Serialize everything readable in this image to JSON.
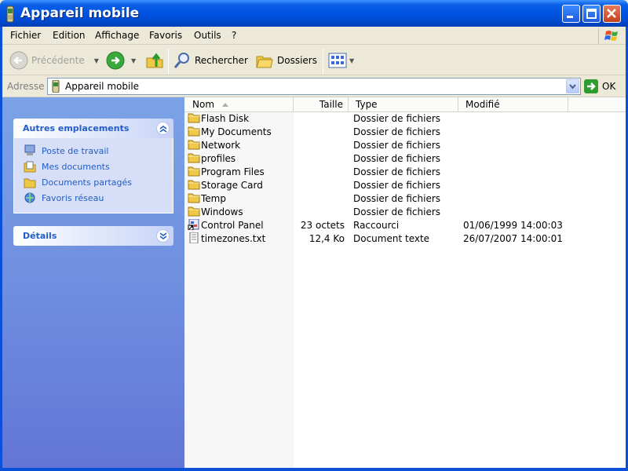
{
  "window": {
    "title": "Appareil mobile"
  },
  "menu": [
    "Fichier",
    "Edition",
    "Affichage",
    "Favoris",
    "Outils",
    "?"
  ],
  "toolbar": {
    "back_label": "Précédente",
    "search_label": "Rechercher",
    "folders_label": "Dossiers"
  },
  "address": {
    "label": "Adresse",
    "value": "Appareil mobile",
    "go_label": "OK"
  },
  "sidebar": {
    "other_places": {
      "title": "Autres emplacements",
      "items": [
        {
          "label": "Poste de travail",
          "icon": "my-computer-icon"
        },
        {
          "label": "Mes documents",
          "icon": "my-documents-icon"
        },
        {
          "label": "Documents partagés",
          "icon": "shared-documents-icon"
        },
        {
          "label": "Favoris réseau",
          "icon": "network-places-icon"
        }
      ]
    },
    "details": {
      "title": "Détails"
    }
  },
  "filelist": {
    "columns": [
      "Nom",
      "Taille",
      "Type",
      "Modifié"
    ],
    "rows": [
      {
        "name": "Flash Disk",
        "size": "",
        "type": "Dossier de fichiers",
        "modified": "",
        "icon": "folder-icon"
      },
      {
        "name": "My Documents",
        "size": "",
        "type": "Dossier de fichiers",
        "modified": "",
        "icon": "folder-icon"
      },
      {
        "name": "Network",
        "size": "",
        "type": "Dossier de fichiers",
        "modified": "",
        "icon": "folder-icon"
      },
      {
        "name": "profiles",
        "size": "",
        "type": "Dossier de fichiers",
        "modified": "",
        "icon": "folder-icon"
      },
      {
        "name": "Program Files",
        "size": "",
        "type": "Dossier de fichiers",
        "modified": "",
        "icon": "folder-icon"
      },
      {
        "name": "Storage Card",
        "size": "",
        "type": "Dossier de fichiers",
        "modified": "",
        "icon": "folder-icon"
      },
      {
        "name": "Temp",
        "size": "",
        "type": "Dossier de fichiers",
        "modified": "",
        "icon": "folder-icon"
      },
      {
        "name": "Windows",
        "size": "",
        "type": "Dossier de fichiers",
        "modified": "",
        "icon": "folder-icon"
      },
      {
        "name": "Control Panel",
        "size": "23 octets",
        "type": "Raccourci",
        "modified": "01/06/1999  14:00:03",
        "icon": "shortcut-icon"
      },
      {
        "name": "timezones.txt",
        "size": "12,4 Ko",
        "type": "Document texte",
        "modified": "26/07/2007  14:00:01",
        "icon": "text-file-icon"
      }
    ]
  }
}
